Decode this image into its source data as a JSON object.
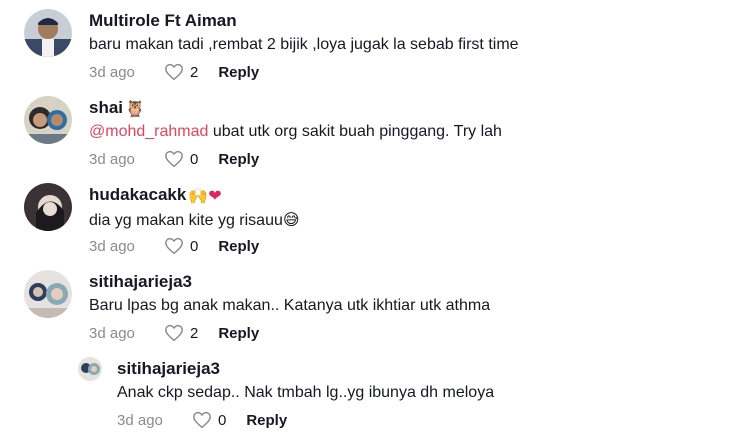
{
  "comments": [
    {
      "username": "Multirole Ft Aiman",
      "emoji": "",
      "mention": "",
      "text": "baru makan tadi ,rembat 2 bijik ,loya jugak la sebab first time",
      "time": "3d ago",
      "likes": "2",
      "reply_label": "Reply"
    },
    {
      "username": "shai",
      "emoji": "🦉",
      "mention": "@mohd_rahmad",
      "text": " ubat utk org sakit buah pinggang. Try lah",
      "time": "3d ago",
      "likes": "0",
      "reply_label": "Reply"
    },
    {
      "username": "hudakacakk",
      "emoji": "🙌❤",
      "mention": "",
      "text": "dia yg makan kite yg risauu😅",
      "time": "3d ago",
      "likes": "0",
      "reply_label": "Reply"
    },
    {
      "username": "sitihajarieja3",
      "emoji": "",
      "mention": "",
      "text": "Baru lpas bg anak makan.. Katanya utk ikhtiar utk athma",
      "time": "3d ago",
      "likes": "2",
      "reply_label": "Reply"
    },
    {
      "username": "sitihajarieja3",
      "emoji": "",
      "mention": "",
      "text": "Anak ckp sedap.. Nak tmbah lg..yg ibunya dh meloya",
      "time": "3d ago",
      "likes": "0",
      "reply_label": "Reply"
    }
  ],
  "colors": {
    "mention": "#e0435f",
    "meta_gray": "#8a8b91",
    "heart_emoji": "#e0245e"
  },
  "icons": {
    "like": "heart-outline-icon"
  }
}
